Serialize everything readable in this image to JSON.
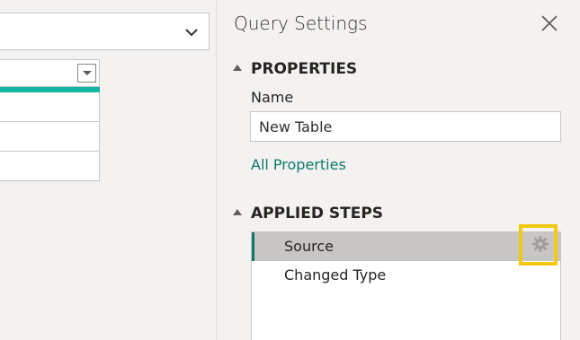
{
  "panel": {
    "title": "Query Settings",
    "close_icon": "close-icon"
  },
  "properties": {
    "header": "PROPERTIES",
    "name_label": "Name",
    "name_value": "New Table",
    "all_properties_link": "All Properties"
  },
  "applied_steps": {
    "header": "APPLIED STEPS",
    "steps": [
      {
        "label": "Source",
        "selected": true,
        "settings_icon": "gear-icon"
      },
      {
        "label": "Changed Type",
        "selected": false
      }
    ]
  },
  "colors": {
    "accent": "#117865",
    "link": "#0e7a6b",
    "quality_bar": "#15b5a4",
    "highlight": "#f2c811"
  }
}
